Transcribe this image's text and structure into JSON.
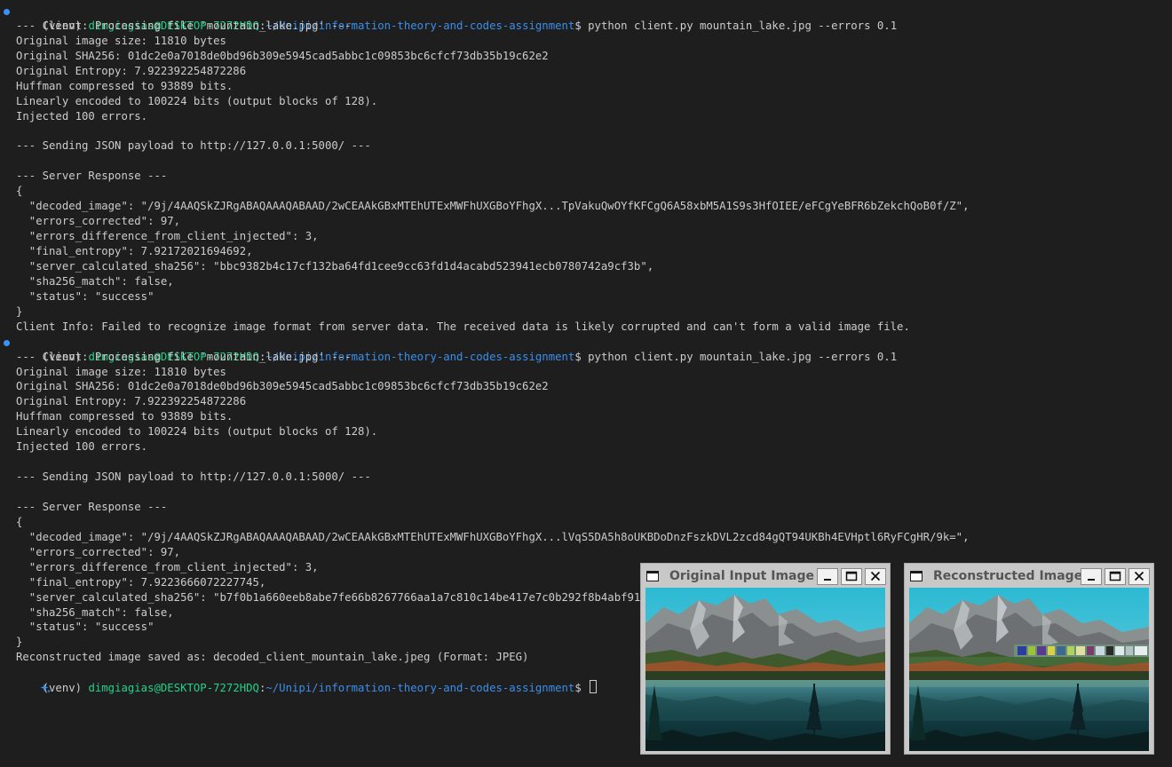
{
  "terminal": {
    "prompt": {
      "venv": "(venv) ",
      "user_host": "dimgiagias@DESKTOP-7272HDQ",
      "separator": ":",
      "path": "~/Unipi/information-theory-and-codes-assignment",
      "symbol": "$ "
    },
    "run1": {
      "command": "python client.py mountain_lake.jpg --errors 0.1",
      "lines": [
        "--- Client: Processing file 'mountain_lake.jpg' ---",
        "Original image size: 11810 bytes",
        "Original SHA256: 01dc2e0a7018de0bd96b309e5945cad5abbc1c09853bc6cfcf73db35b19c62e2",
        "Original Entropy: 7.922392254872286",
        "Huffman compressed to 93889 bits.",
        "Linearly encoded to 100224 bits (output blocks of 128).",
        "Injected 100 errors.",
        "",
        "--- Sending JSON payload to http://127.0.0.1:5000/ ---",
        "",
        "--- Server Response ---",
        "{",
        "  \"decoded_image\": \"/9j/4AAQSkZJRgABAQAAAQABAAD/2wCEAAkGBxMTEhUTExMWFhUXGBoYFhgX...TpVakuQwOYfKFCgQ6A58xbM5A1S9s3HfOIEE/eFCgYeBFR6bZekchQoB0f/Z\",",
        "  \"errors_corrected\": 97,",
        "  \"errors_difference_from_client_injected\": 3,",
        "  \"final_entropy\": 7.92172021694692,",
        "  \"server_calculated_sha256\": \"bbc9382b4c17cf132ba64fd1cee9cc63fd1d4acabd523941ecb0780742a9cf3b\",",
        "  \"sha256_match\": false,",
        "  \"status\": \"success\"",
        "}",
        "Client Info: Failed to recognize image format from server data. The received data is likely corrupted and can't form a valid image file."
      ]
    },
    "run2": {
      "command": "python client.py mountain_lake.jpg --errors 0.1",
      "lines": [
        "--- Client: Processing file 'mountain_lake.jpg' ---",
        "Original image size: 11810 bytes",
        "Original SHA256: 01dc2e0a7018de0bd96b309e5945cad5abbc1c09853bc6cfcf73db35b19c62e2",
        "Original Entropy: 7.922392254872286",
        "Huffman compressed to 93889 bits.",
        "Linearly encoded to 100224 bits (output blocks of 128).",
        "Injected 100 errors.",
        "",
        "--- Sending JSON payload to http://127.0.0.1:5000/ ---",
        "",
        "--- Server Response ---",
        "{",
        "  \"decoded_image\": \"/9j/4AAQSkZJRgABAQAAAQABAAD/2wCEAAkGBxMTEhUTExMWFhUXGBoYFhgX...lVqS5DA5h8oUKBDoDnzFszkDVL2zcd84gQT94UKBh4EVHptl6RyFCgHR/9k=\",",
        "  \"errors_corrected\": 97,",
        "  \"errors_difference_from_client_injected\": 3,",
        "  \"final_entropy\": 7.9223666072227745,",
        "  \"server_calculated_sha256\": \"b7f0b1a660eeb8abe7fe66b8267766aa1a7c810c14be417e7c0b292f8b4abf91\",",
        "  \"sha256_match\": false,",
        "  \"status\": \"success\"",
        "}",
        "Reconstructed image saved as: decoded_client_mountain_lake.jpeg (Format: JPEG)"
      ]
    },
    "colors": {
      "background": "#1e1e1e",
      "text": "#cccccc",
      "user_host": "#23d18b",
      "path": "#3b8eea",
      "marker": "#3794ff"
    }
  },
  "windows": {
    "original": {
      "title": "Original Input Image",
      "image_icon": "mountain-lake-image"
    },
    "reconstructed": {
      "title": "Reconstructed Image",
      "image_icon": "mountain-lake-image-corrupted"
    }
  }
}
